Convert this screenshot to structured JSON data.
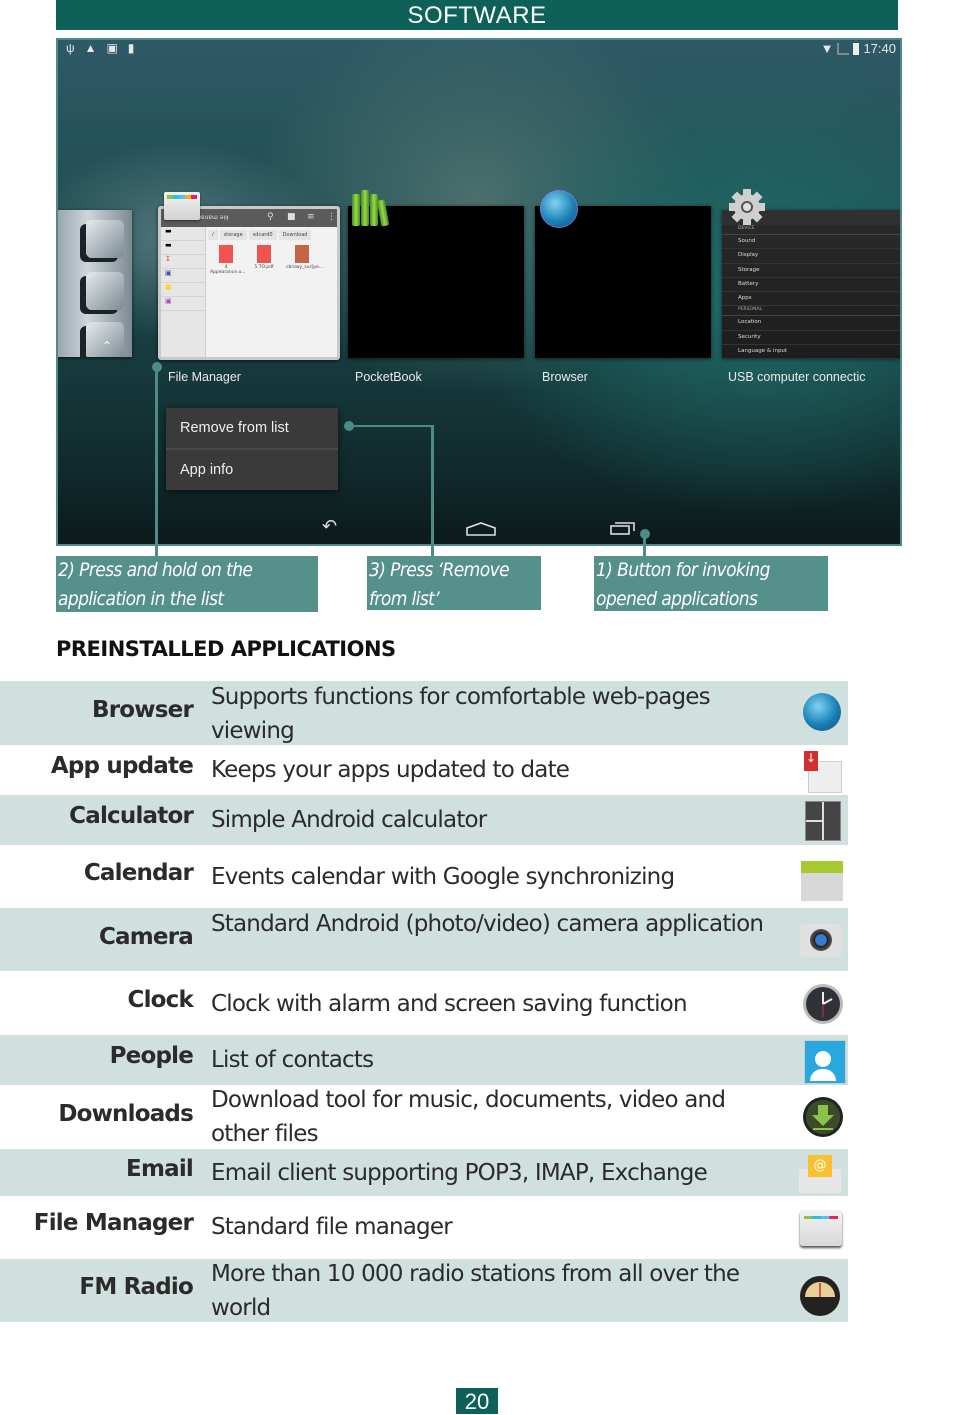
{
  "header": {
    "title": "SOFTWARE"
  },
  "screenshot": {
    "status_bar": {
      "left_icons": [
        "usb-icon",
        "warning-icon",
        "screenshot-icon",
        "barcode-icon"
      ],
      "right_icons": [
        "wifi-icon",
        "signal-icon",
        "battery-icon"
      ],
      "time": "17:40"
    },
    "recent_apps": [
      {
        "label": "File Manager",
        "icon": "file-manager-icon"
      },
      {
        "label": "PocketBook",
        "icon": "books-icon"
      },
      {
        "label": "Browser",
        "icon": "globe-icon"
      },
      {
        "label": "USB computer connectic",
        "icon": "gear-icon"
      }
    ],
    "file_manager_preview": {
      "title": "ɹǝƃɐuɐɯ ǝןıɟ",
      "breadcrumbs": [
        "/",
        "storage",
        "sdcard0",
        "Download"
      ],
      "files": [
        "4 Appearance.o...",
        "5 TO.pdf",
        "cbrowy_sur[pe..."
      ]
    },
    "settings_preview": {
      "sections": [
        {
          "header": "DEVICE",
          "items": [
            "Sound",
            "Display",
            "Storage",
            "Battery",
            "Apps"
          ]
        },
        {
          "header": "PERSONAL",
          "items": [
            "Location",
            "Security",
            "Language & input"
          ]
        }
      ]
    },
    "context_menu": {
      "items": [
        "Remove from list",
        "App info"
      ]
    },
    "nav_bar": {
      "buttons": [
        "back-icon",
        "home-icon",
        "recents-icon"
      ]
    }
  },
  "callouts": [
    {
      "text": "2) Press and hold on the application in the list"
    },
    {
      "text": "3) Press ‘Remove from list’"
    },
    {
      "text": "1) Button for invoking opened applications"
    }
  ],
  "section_title": "PREINSTALLED APPLICATIONS",
  "colors": {
    "header": "#0e6158",
    "callout": "#55908b",
    "row_shade": "#d0e0df"
  },
  "apps": [
    {
      "name": "Browser",
      "description": "Supports functions for comfortable web-pages viewing",
      "icon": "globe-icon"
    },
    {
      "name": "App update",
      "description": "Keeps your apps updated to date",
      "icon": "app-update-icon"
    },
    {
      "name": "Calculator",
      "description": "Simple Android calculator",
      "icon": "calculator-icon"
    },
    {
      "name": "Calendar",
      "description": "Events calendar with Google synchronizing",
      "icon": "calendar-icon"
    },
    {
      "name": "Camera",
      "description": "Standard Android (photo/video) camera application",
      "icon": "camera-icon"
    },
    {
      "name": "Clock",
      "description": "Clock with alarm and screen saving function",
      "icon": "clock-icon"
    },
    {
      "name": "People",
      "description": "List of contacts",
      "icon": "contacts-icon"
    },
    {
      "name": "Downloads",
      "description": "Download tool for music, documents, video and other files",
      "icon": "download-icon"
    },
    {
      "name": "Email",
      "description": "Email client supporting POP3, IMAP, Exchange",
      "icon": "email-icon"
    },
    {
      "name": "File Manager",
      "description": "Standard file manager",
      "icon": "file-manager-icon"
    },
    {
      "name": "FM Radio",
      "description": "More than 10 000 radio stations from all over the world",
      "icon": "radio-icon"
    }
  ],
  "page_number": "20"
}
